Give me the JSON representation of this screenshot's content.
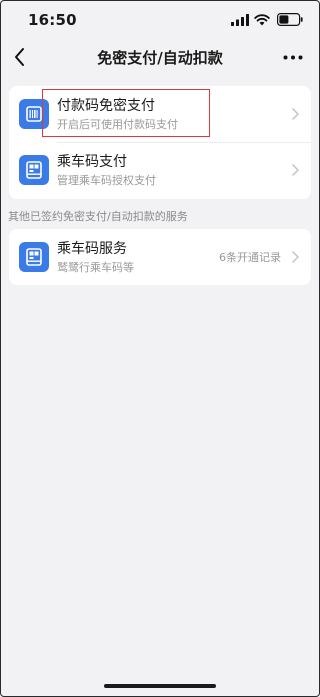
{
  "status_bar": {
    "time": "16:50"
  },
  "nav": {
    "title": "免密支付/自动扣款"
  },
  "primary_list": [
    {
      "title": "付款码免密支付",
      "subtitle": "开启后可使用付款码支付",
      "icon": "payment-code-icon"
    },
    {
      "title": "乘车码支付",
      "subtitle": "管理乘车码授权支付",
      "icon": "transit-code-icon"
    }
  ],
  "section_label": "其他已签约免密支付/自动扣款的服务",
  "service_list": [
    {
      "title": "乘车码服务",
      "subtitle": "鹫鹭行乘车码等",
      "right_text": "6条开通记录",
      "icon": "transit-code-icon"
    }
  ],
  "colors": {
    "accent": "#3a7be8",
    "highlight": "#e0383e",
    "background": "#f2f2f4"
  }
}
